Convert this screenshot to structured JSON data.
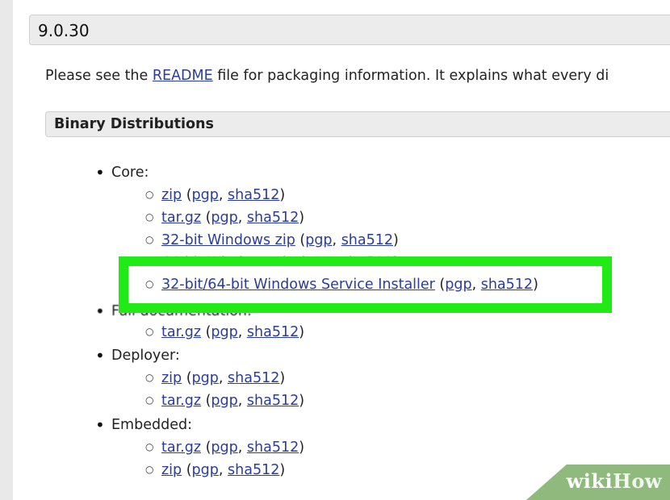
{
  "version_title": "9.0.30",
  "intro": {
    "prefix": "Please see the ",
    "link": "README",
    "suffix": " file for packaging information. It explains what every di"
  },
  "section_title": "Binary Distributions",
  "groups": [
    {
      "label": "Core:",
      "items": [
        {
          "name": "zip",
          "pgp": "pgp",
          "sha": "sha512"
        },
        {
          "name": "tar.gz",
          "pgp": "pgp",
          "sha": "sha512"
        },
        {
          "name": "32-bit Windows zip",
          "pgp": "pgp",
          "sha": "sha512"
        },
        {
          "name": "64-bit Windows zip",
          "pgp": "pgp",
          "sha": "sha512"
        },
        {
          "name": "32-bit/64-bit Windows Service Installer",
          "pgp": "pgp",
          "sha": "sha512"
        }
      ]
    },
    {
      "label": "Full documentation:",
      "items": [
        {
          "name": "tar.gz",
          "pgp": "pgp",
          "sha": "sha512"
        }
      ]
    },
    {
      "label": "Deployer:",
      "items": [
        {
          "name": "zip",
          "pgp": "pgp",
          "sha": "sha512"
        },
        {
          "name": "tar.gz",
          "pgp": "pgp",
          "sha": "sha512"
        }
      ]
    },
    {
      "label": "Embedded:",
      "items": [
        {
          "name": "tar.gz",
          "pgp": "pgp",
          "sha": "sha512"
        },
        {
          "name": "zip",
          "pgp": "pgp",
          "sha": "sha512"
        }
      ]
    }
  ],
  "punct": {
    "open": " (",
    "comma": ", ",
    "close": ")"
  },
  "watermark": {
    "wiki": "wiki",
    "how": "How"
  },
  "colors": {
    "highlight": "#21ea16",
    "link": "#2a3d9c",
    "watermark_bg": "#8fb97d"
  }
}
